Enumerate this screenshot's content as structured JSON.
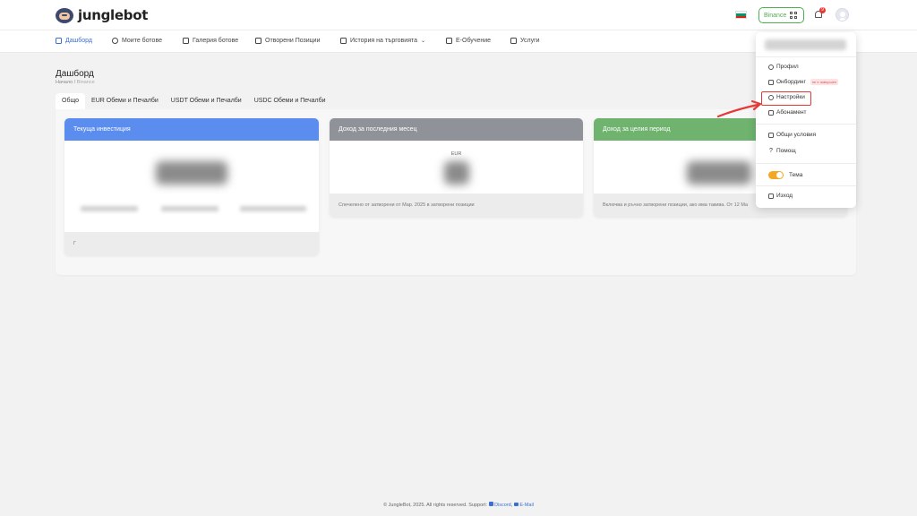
{
  "brand": {
    "name": "junglebot"
  },
  "header": {
    "exchange_label": "Binance",
    "notifications_count": "9"
  },
  "nav": [
    {
      "label": "Дашборд",
      "active": true
    },
    {
      "label": "Моите ботове"
    },
    {
      "label": "Галерия ботове"
    },
    {
      "label": "Отворени Позиции"
    },
    {
      "label": "История на търговията"
    },
    {
      "label": "Е-Обучение"
    },
    {
      "label": "Услуги"
    }
  ],
  "page": {
    "title": "Дашборд",
    "breadcrumb_home": "Начало",
    "breadcrumb_sep": "/",
    "breadcrumb_current": "Binance"
  },
  "tabs": [
    "Общо",
    "EUR Обеми и Печалби",
    "USDT Обеми и Печалби",
    "USDC Обеми и Печалби"
  ],
  "cards": [
    {
      "title": "Текуща инвестиция",
      "color": "#5b8def",
      "footer": "Г"
    },
    {
      "title": "Доход за последния месец",
      "color": "#8f9399",
      "sub": "EUR",
      "footer": "Спечелено от затворени от Мар. 2025 в затворени позиции"
    },
    {
      "title": "Доход за целия период",
      "color": "#6fb36f",
      "footer": "Включва и ръчно затворени позиции, ако има такива. От 12 Ма"
    }
  ],
  "dropdown": {
    "items": [
      {
        "label": "Профил"
      },
      {
        "label": "Онбординг",
        "tag": "не е завършен"
      },
      {
        "label": "Настройки"
      },
      {
        "label": "Абонамент"
      },
      {
        "label": "Общи условия"
      },
      {
        "label": "Помощ",
        "prefix": "?"
      },
      {
        "label": "Тема"
      },
      {
        "label": "Изход"
      }
    ]
  },
  "footer": {
    "text": "© JungleBot, 2025. All rights reserved. Support:",
    "discord": "Discord",
    "sep": ",",
    "email": "E-Mail"
  },
  "colors": {
    "accent": "#3a6fd6",
    "success": "#4caf50",
    "danger": "#e53935",
    "toggle": "#f5a623"
  }
}
